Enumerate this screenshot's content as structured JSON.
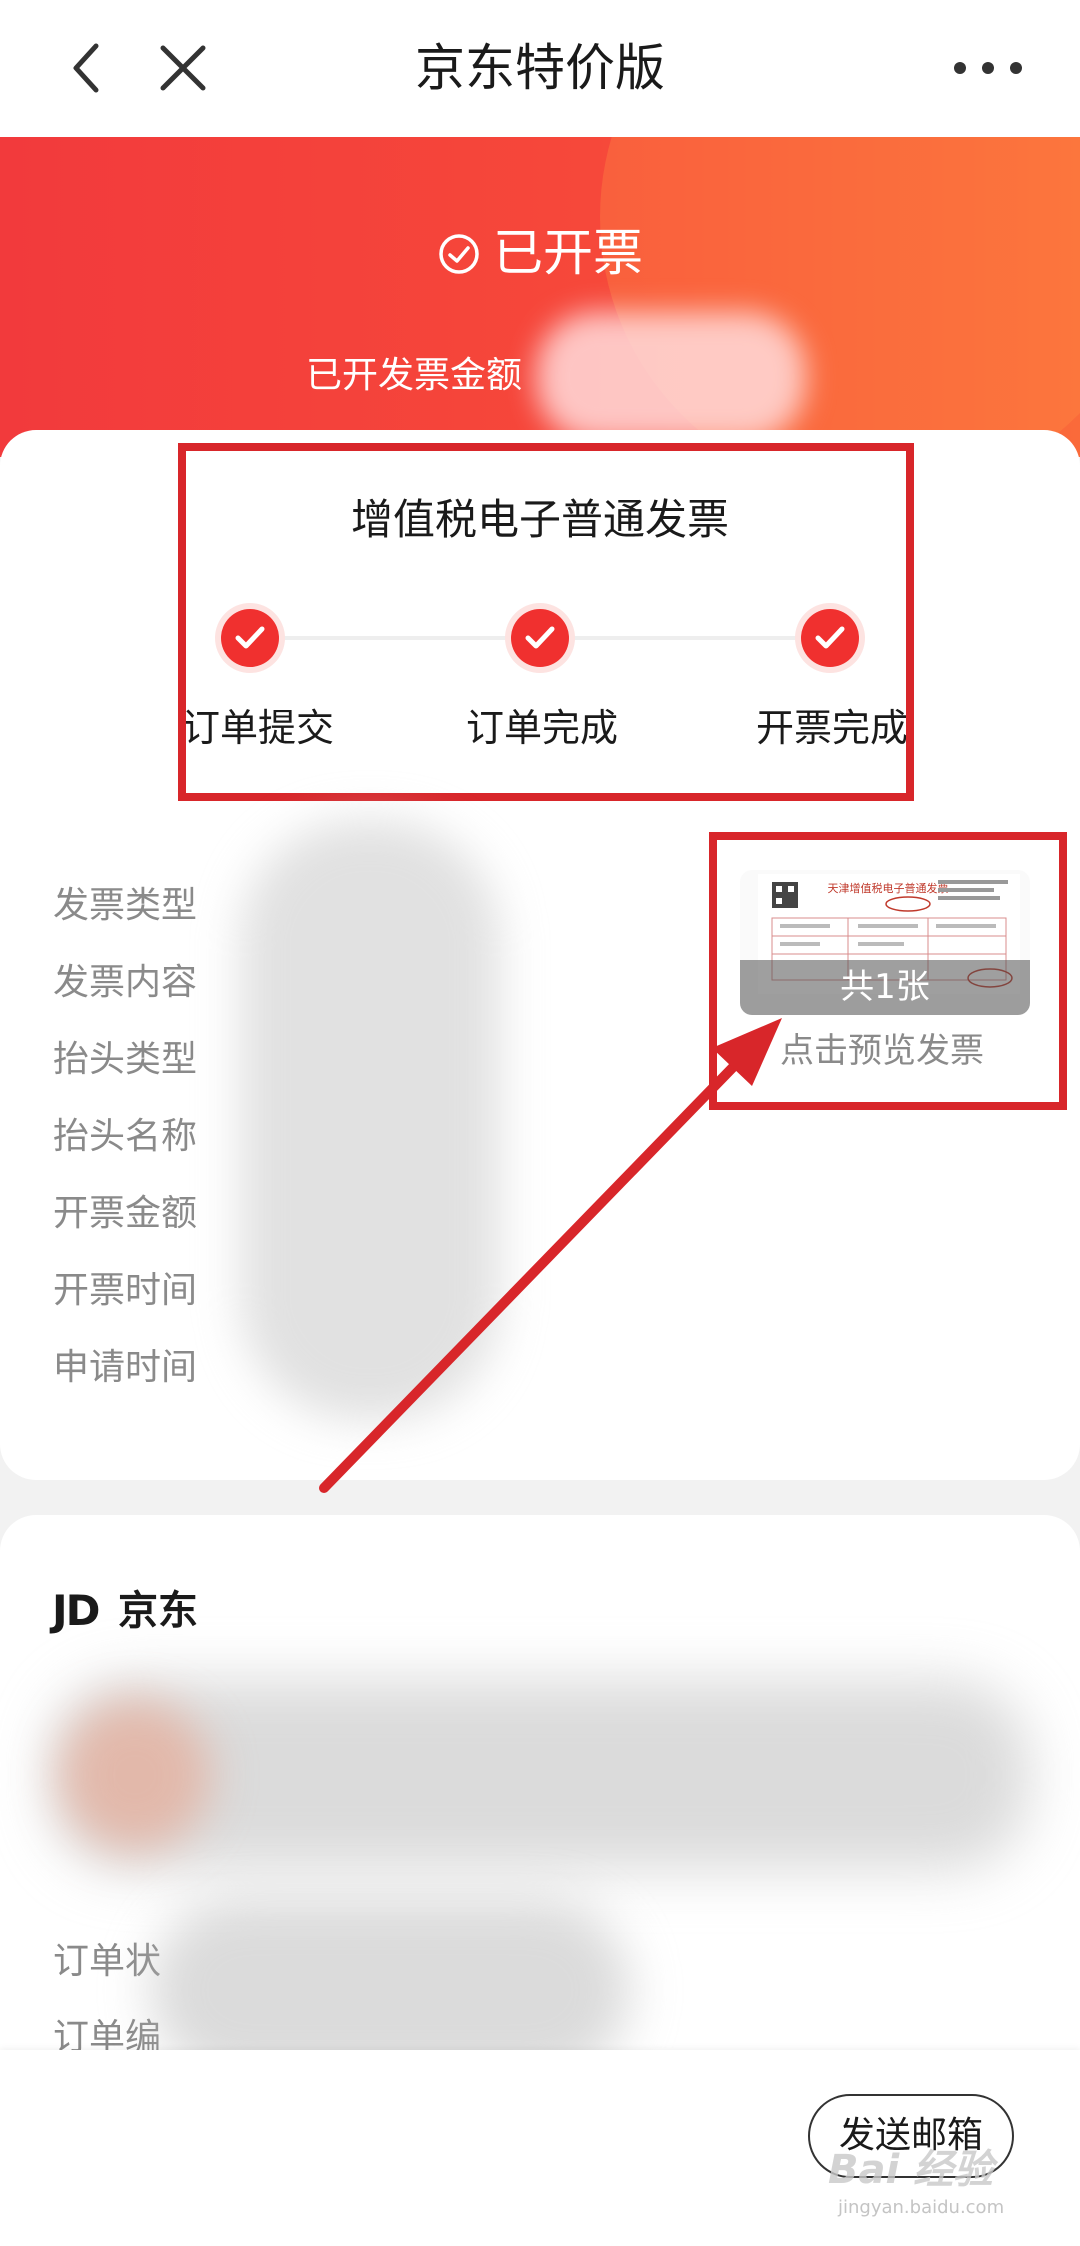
{
  "nav": {
    "title": "京东特价版",
    "back_icon": "chevron-left-icon",
    "close_icon": "close-icon",
    "more_icon": "more-horizontal-icon"
  },
  "banner": {
    "status": "已开票",
    "amount_label": "已开发票金额",
    "status_icon": "check-circle-icon"
  },
  "invoice": {
    "type_title": "增值税电子普通发票",
    "steps": [
      {
        "label": "订单提交",
        "done": true
      },
      {
        "label": "订单完成",
        "done": true
      },
      {
        "label": "开票完成",
        "done": true
      }
    ],
    "fields": [
      {
        "label": "发票类型"
      },
      {
        "label": "发票内容"
      },
      {
        "label": "抬头类型"
      },
      {
        "label": "抬头名称"
      },
      {
        "label": "开票金额"
      },
      {
        "label": "开票时间"
      },
      {
        "label": "申请时间"
      }
    ],
    "preview": {
      "count": "共1张",
      "hint": "点击预览发票",
      "doc_title": "天津增值税电子普通发票"
    }
  },
  "order": {
    "shop_logo": "JD",
    "shop_name": "京东",
    "labels": [
      "订单状",
      "订单编"
    ]
  },
  "bottom": {
    "send_button": "发送邮箱"
  },
  "watermark": {
    "text": "Bai 经验",
    "url": "jingyan.baidu.com"
  },
  "colors": {
    "accent_red": "#f0302f",
    "banner_start": "#f23a3c",
    "banner_end": "#fa6a3a",
    "annotation_red": "#d8262a"
  }
}
